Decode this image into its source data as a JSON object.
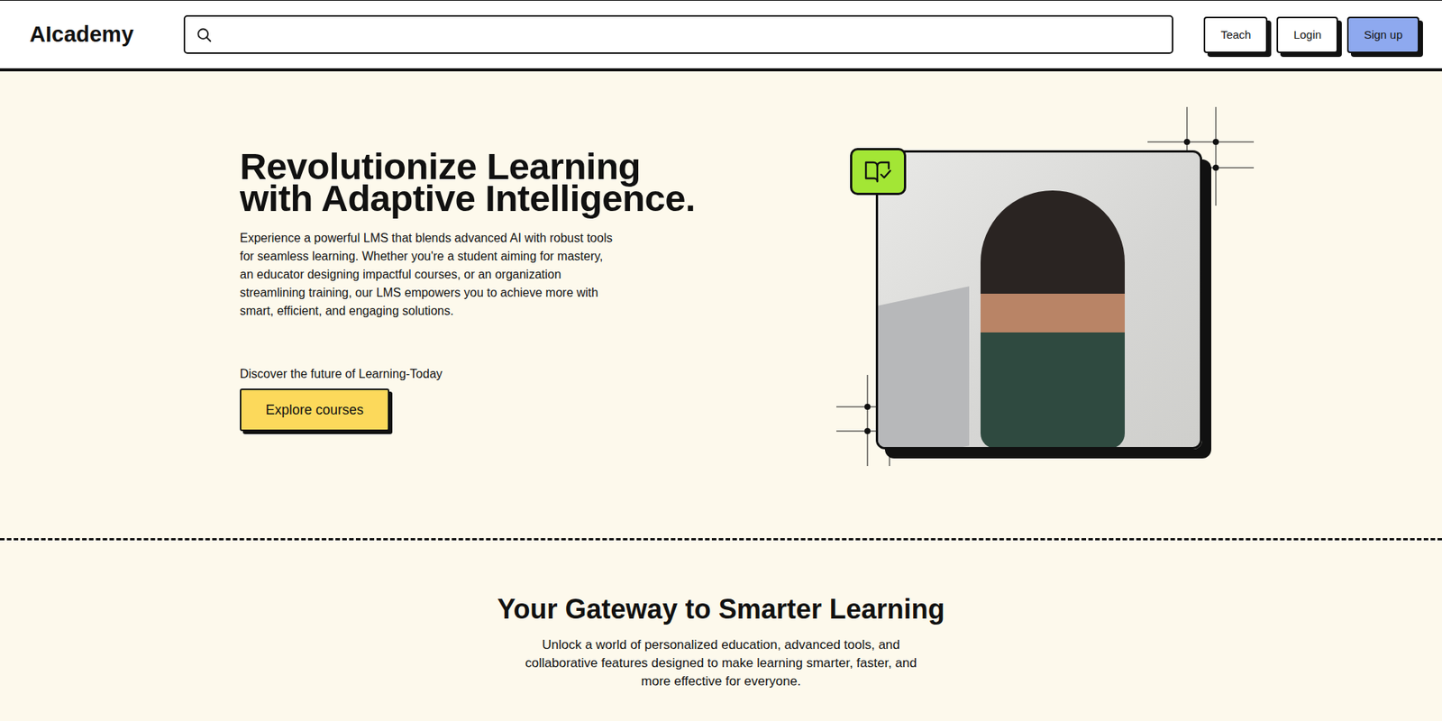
{
  "header": {
    "logo": "AIcademy",
    "search": {
      "placeholder": ""
    },
    "buttons": [
      {
        "label": "Teach",
        "kind": "secondary"
      },
      {
        "label": "Login",
        "kind": "secondary"
      },
      {
        "label": "Sign up",
        "kind": "primary"
      }
    ]
  },
  "hero": {
    "title_lines": [
      "Revolutionize Learning",
      "with Adaptive Intelligence."
    ],
    "description": "Experience a powerful LMS that blends advanced AI with robust tools for seamless learning. Whether you're a student aiming for mastery, an educator designing impactful courses, or an organization streamlining training, our LMS empowers you to achieve more with smart, efficient, and engaging solutions.",
    "tagline": "Discover the future of Learning-Today",
    "cta": "Explore courses"
  },
  "features": {
    "title": "Your Gateway to Smarter Learning",
    "subtitle": "Unlock a world of personalized education, advanced tools, and collaborative features designed to make learning smarter, faster, and more effective for everyone."
  }
}
